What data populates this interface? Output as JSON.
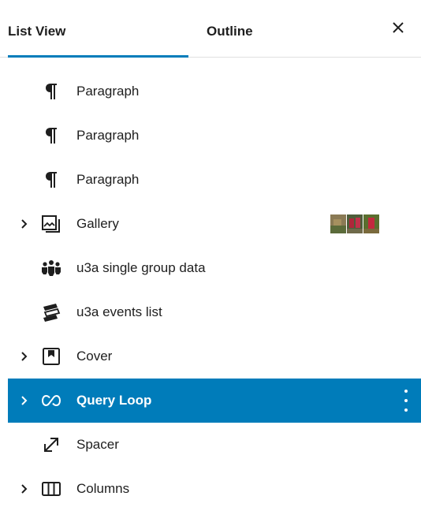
{
  "tabs": {
    "list_view": "List View",
    "outline": "Outline"
  },
  "icons": {
    "close": "close-icon",
    "paragraph": "paragraph-icon",
    "gallery": "gallery-icon",
    "group_data": "people-group-icon",
    "events": "events-stack-icon",
    "cover": "cover-icon",
    "query_loop": "loop-icon",
    "spacer": "spacer-resize-icon",
    "columns": "columns-icon"
  },
  "blocks": [
    {
      "label": "Paragraph"
    },
    {
      "label": "Paragraph"
    },
    {
      "label": "Paragraph"
    },
    {
      "label": "Gallery"
    },
    {
      "label": "u3a single group data"
    },
    {
      "label": "u3a events list"
    },
    {
      "label": "Cover"
    },
    {
      "label": "Query Loop"
    },
    {
      "label": "Spacer"
    },
    {
      "label": "Columns"
    }
  ],
  "colors": {
    "accent": "#007cba",
    "text": "#1e1e1e"
  }
}
